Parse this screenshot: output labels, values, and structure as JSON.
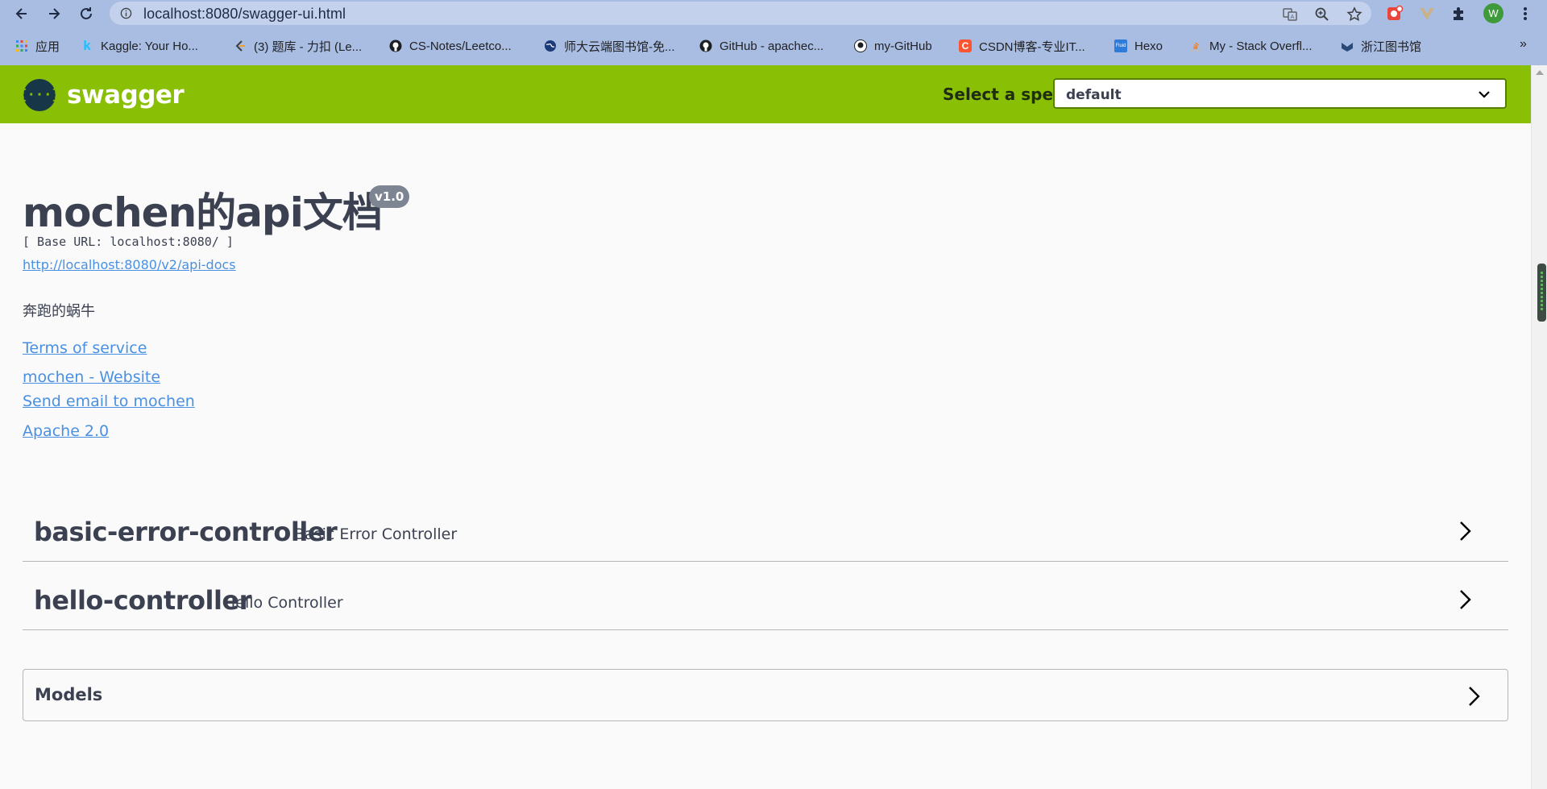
{
  "browser": {
    "url": "localhost:8080/swagger-ui.html",
    "bookmarks": [
      {
        "label": "应用",
        "icon": "apps-grid-icon"
      },
      {
        "label": "Kaggle: Your Ho...",
        "icon": "kaggle-icon"
      },
      {
        "label": "(3) 题库 - 力扣 (Le...",
        "icon": "leetcode-icon"
      },
      {
        "label": "CS-Notes/Leetco...",
        "icon": "github-icon"
      },
      {
        "label": "师大云端图书馆-免...",
        "icon": "globe-icon"
      },
      {
        "label": "GitHub - apachec...",
        "icon": "github-icon"
      },
      {
        "label": "my-GitHub",
        "icon": "github-icon"
      },
      {
        "label": "CSDN博客-专业IT...",
        "icon": "csdn-icon"
      },
      {
        "label": "Hexo",
        "icon": "fluid-icon"
      },
      {
        "label": "My - Stack Overfl...",
        "icon": "stackoverflow-icon"
      },
      {
        "label": "浙江图书馆",
        "icon": "library-icon"
      }
    ],
    "avatar_letter": "W",
    "more": "»"
  },
  "topbar": {
    "logo_text": "swagger",
    "spec_label": "Select a spec",
    "spec_value": "default",
    "accent": "#89bf04"
  },
  "info": {
    "title": "mochen的api文档",
    "version": "v1.0",
    "base_url": "[ Base URL: localhost:8080/ ]",
    "api_docs_link": "http://localhost:8080/v2/api-docs",
    "description": "奔跑的蜗牛",
    "terms": "Terms of service",
    "website": "mochen - Website",
    "email": "Send email to mochen",
    "license": "Apache 2.0"
  },
  "tags": [
    {
      "name": "basic-error-controller",
      "description": "Basic Error Controller"
    },
    {
      "name": "hello-controller",
      "description": "Hello Controller"
    }
  ],
  "models": {
    "label": "Models"
  }
}
